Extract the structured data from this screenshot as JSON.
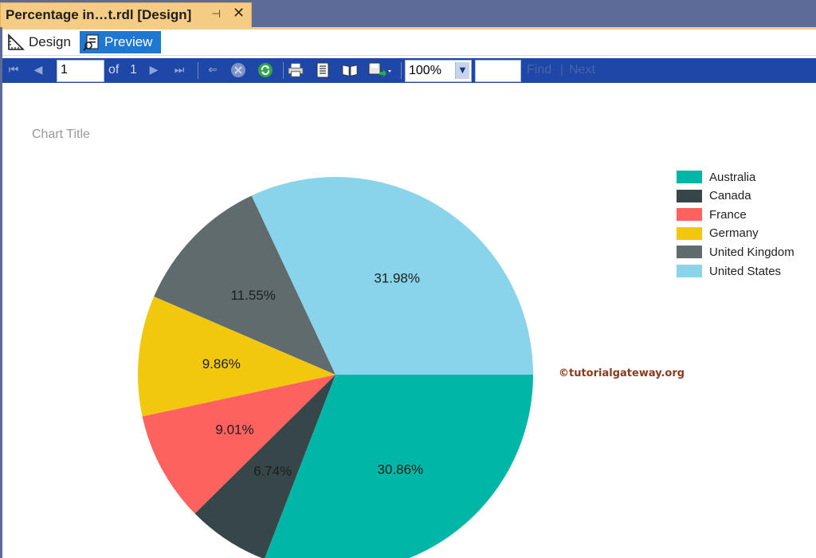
{
  "tab": {
    "title": "Percentage in…t.rdl [Design]"
  },
  "modes": {
    "design_label": "Design",
    "preview_label": "Preview"
  },
  "toolbar": {
    "page_value": "1",
    "of_label": "of",
    "total_pages": "1",
    "zoom_value": "100%",
    "find_label": "Find",
    "next_label": "Next"
  },
  "colors": {
    "Australia": "#00b6a6",
    "Canada": "#374649",
    "France": "#fd625e",
    "Germany": "#f2c80f",
    "United Kingdom": "#5f6b6d",
    "United States": "#8ad4eb"
  },
  "watermark": "©tutorialgateway.org",
  "chart_data": {
    "type": "pie",
    "title": "Chart Title",
    "legend_position": "top-right",
    "categories": [
      "Australia",
      "Canada",
      "France",
      "Germany",
      "United Kingdom",
      "United States"
    ],
    "values": [
      30.86,
      6.74,
      9.01,
      9.86,
      11.55,
      31.98
    ],
    "labels": [
      "30.86%",
      "6.74%",
      "9.01%",
      "9.86%",
      "11.55%",
      "31.98%"
    ]
  }
}
